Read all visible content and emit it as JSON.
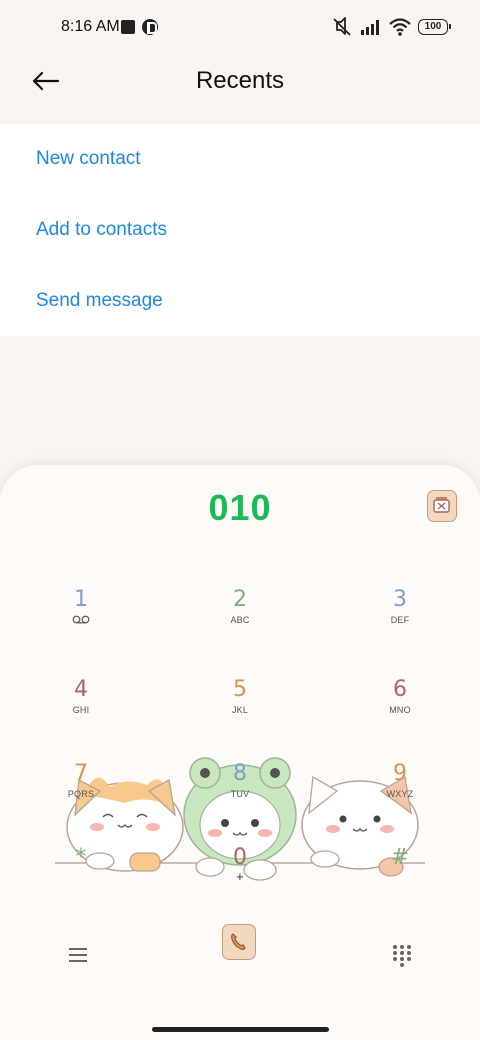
{
  "status_bar": {
    "time": "8:16 AM",
    "battery": "100"
  },
  "header": {
    "title": "Recents"
  },
  "menu": {
    "items": [
      {
        "label": "New contact"
      },
      {
        "label": "Add to contacts"
      },
      {
        "label": "Send message"
      }
    ]
  },
  "dialer": {
    "number": "010",
    "keys": [
      {
        "digit": "1",
        "letters": "",
        "color": "#7f9fc8"
      },
      {
        "digit": "2",
        "letters": "ABC",
        "color": "#7fae7e"
      },
      {
        "digit": "3",
        "letters": "DEF",
        "color": "#7f9fc8"
      },
      {
        "digit": "4",
        "letters": "GHI",
        "color": "#a56a5c"
      },
      {
        "digit": "5",
        "letters": "JKL",
        "color": "#d4954f"
      },
      {
        "digit": "6",
        "letters": "MNO",
        "color": "#a56a5c"
      },
      {
        "digit": "7",
        "letters": "PQRS",
        "color": "#d4954f"
      },
      {
        "digit": "8",
        "letters": "TUV",
        "color": "#7f9fc8"
      },
      {
        "digit": "9",
        "letters": "WXYZ",
        "color": "#d4954f"
      },
      {
        "digit": "*",
        "letters": "",
        "color": "#7fae7e"
      },
      {
        "digit": "0",
        "letters": "+",
        "color": "#a56a5c"
      },
      {
        "digit": "#",
        "letters": "",
        "color": "#7fae7e"
      }
    ],
    "number_color": "#1db954"
  },
  "colors": {
    "accent": "#1e88e5",
    "background": "#faf5f1"
  }
}
